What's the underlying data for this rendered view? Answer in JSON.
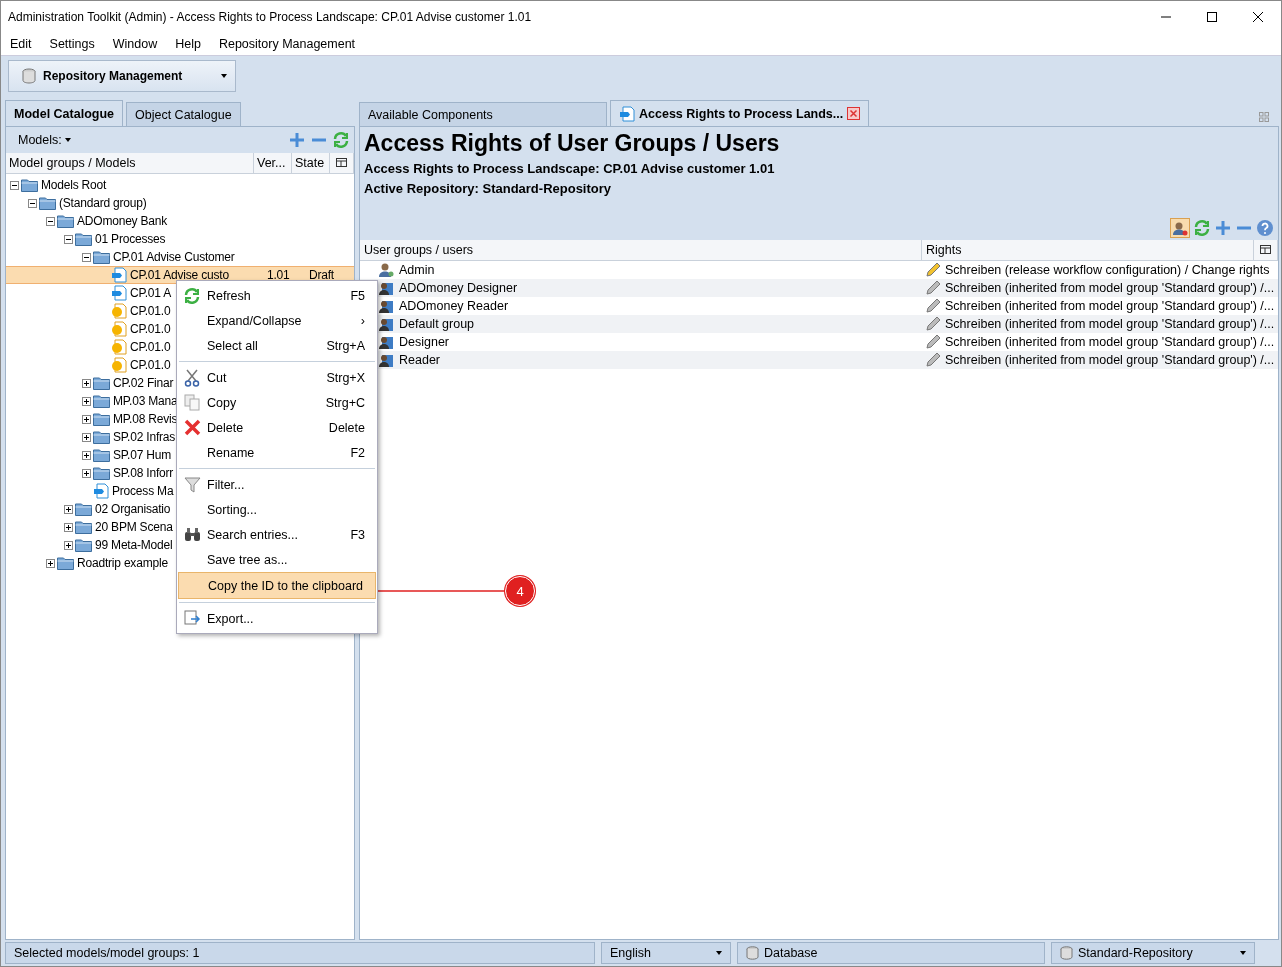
{
  "window": {
    "title": "Administration Toolkit (Admin) - Access Rights to Process Landscape: CP.01 Advise customer 1.01"
  },
  "menu_bar": [
    "Edit",
    "Settings",
    "Window",
    "Help",
    "Repository Management"
  ],
  "toolbar": {
    "component": "Repository Management"
  },
  "left_tabs": [
    {
      "label": "Model Catalogue",
      "selected": true
    },
    {
      "label": "Object Catalogue",
      "selected": false
    }
  ],
  "models_label": "Models:",
  "tree_columns": [
    "Model groups / Models",
    "Ver...",
    "State"
  ],
  "tree": [
    {
      "label": "Models Root",
      "kind": "folder",
      "expanded": true,
      "selected": false,
      "children": [
        {
          "label": "(Standard group)",
          "kind": "folder",
          "expanded": true,
          "selected": false,
          "children": [
            {
              "label": "ADOmoney Bank",
              "kind": "folder",
              "expanded": true,
              "selected": false,
              "children": [
                {
                  "label": "01 Processes",
                  "kind": "folder",
                  "expanded": true,
                  "selected": false,
                  "children": [
                    {
                      "label": "CP.01 Advise Customer",
                      "kind": "folder",
                      "expanded": true,
                      "selected": false,
                      "children": [
                        {
                          "label": "CP.01 Advise custo",
                          "kind": "model",
                          "selected": true,
                          "version": "1.01",
                          "state": "Draft"
                        },
                        {
                          "label": "CP.01 A",
                          "kind": "model",
                          "selected": false
                        },
                        {
                          "label": "CP.01.0",
                          "kind": "object",
                          "selected": false
                        },
                        {
                          "label": "CP.01.0",
                          "kind": "object",
                          "selected": false
                        },
                        {
                          "label": "CP.01.0",
                          "kind": "object",
                          "selected": false
                        },
                        {
                          "label": "CP.01.0",
                          "kind": "object",
                          "selected": false
                        }
                      ]
                    },
                    {
                      "label": "CP.02 Finar",
                      "kind": "folder",
                      "expanded": false,
                      "selected": false
                    },
                    {
                      "label": "MP.03 Mana",
                      "kind": "folder",
                      "expanded": false,
                      "selected": false
                    },
                    {
                      "label": "MP.08 Revis",
                      "kind": "folder",
                      "expanded": false,
                      "selected": false
                    },
                    {
                      "label": "SP.02 Infras",
                      "kind": "folder",
                      "expanded": false,
                      "selected": false
                    },
                    {
                      "label": "SP.07 Hum",
                      "kind": "folder",
                      "expanded": false,
                      "selected": false
                    },
                    {
                      "label": "SP.08 Inforr",
                      "kind": "folder",
                      "expanded": false,
                      "selected": false
                    },
                    {
                      "label": "Process Ma",
                      "kind": "model",
                      "selected": false
                    }
                  ]
                },
                {
                  "label": "02 Organisatio",
                  "kind": "folder",
                  "expanded": false,
                  "selected": false
                },
                {
                  "label": "20 BPM Scena",
                  "kind": "folder",
                  "expanded": false,
                  "selected": false
                },
                {
                  "label": "99 Meta-Model",
                  "kind": "folder",
                  "expanded": false,
                  "selected": false
                }
              ]
            },
            {
              "label": "Roadtrip example",
              "kind": "folder",
              "expanded": false,
              "selected": false
            }
          ]
        }
      ]
    }
  ],
  "context_menu": [
    [
      {
        "label": "Refresh",
        "shortcut": "F5",
        "kind": "refresh",
        "selected": false
      },
      {
        "label": "Expand/Collapse",
        "shortcut": "›",
        "kind": "plain",
        "selected": false
      },
      {
        "label": "Select all",
        "shortcut": "Strg+A",
        "kind": "plain",
        "selected": false
      }
    ],
    [
      {
        "label": "Cut",
        "shortcut": "Strg+X",
        "kind": "cut",
        "selected": false
      },
      {
        "label": "Copy",
        "shortcut": "Strg+C",
        "kind": "copy",
        "selected": false
      },
      {
        "label": "Delete",
        "shortcut": "Delete",
        "kind": "delete",
        "selected": false
      },
      {
        "label": "Rename",
        "shortcut": "F2",
        "kind": "plain",
        "selected": false
      }
    ],
    [
      {
        "label": "Filter...",
        "kind": "filter",
        "selected": false
      },
      {
        "label": "Sorting...",
        "kind": "plain",
        "selected": false
      },
      {
        "label": "Search entries...",
        "shortcut": "F3",
        "kind": "search",
        "selected": false
      },
      {
        "label": "Save tree as...",
        "kind": "plain",
        "selected": false
      },
      {
        "label": "Copy the ID to the clipboard",
        "kind": "plain",
        "selected": true
      }
    ],
    [
      {
        "label": "Export...",
        "kind": "export",
        "selected": false
      }
    ]
  ],
  "callout": "4",
  "right_tabs": [
    {
      "label": "Available Components",
      "selected": false,
      "closable": false
    },
    {
      "label": "Access Rights to Process Lands...",
      "selected": true,
      "closable": true
    }
  ],
  "heading": "Access Rights of User Groups / Users",
  "subheadings": [
    "Access Rights to Process Landscape: CP.01 Advise customer 1.01",
    "Active Repository: Standard-Repository"
  ],
  "rights_columns": [
    "User groups / users",
    "Rights"
  ],
  "rights_rows": [
    {
      "user": "Admin",
      "kind": "user",
      "rights": "Schreiben (release workflow configuration) / Change rights",
      "editable": true
    },
    {
      "user": "ADOmoney Designer",
      "kind": "group",
      "rights": "Schreiben (inherited from model group 'Standard group') /...",
      "editable": false
    },
    {
      "user": "ADOmoney Reader",
      "kind": "group",
      "rights": "Schreiben (inherited from model group 'Standard group') /...",
      "editable": false
    },
    {
      "user": "Default group",
      "kind": "group",
      "rights": "Schreiben (inherited from model group 'Standard group') /...",
      "editable": false
    },
    {
      "user": "Designer",
      "kind": "group",
      "rights": "Schreiben (inherited from model group 'Standard group') /...",
      "editable": false
    },
    {
      "user": "Reader",
      "kind": "group",
      "rights": "Schreiben (inherited from model group 'Standard group') /...",
      "editable": false
    }
  ],
  "status_bar": {
    "selection": "Selected models/model groups: 1",
    "language": "English",
    "mode": "Database",
    "repository": "Standard-Repository"
  }
}
